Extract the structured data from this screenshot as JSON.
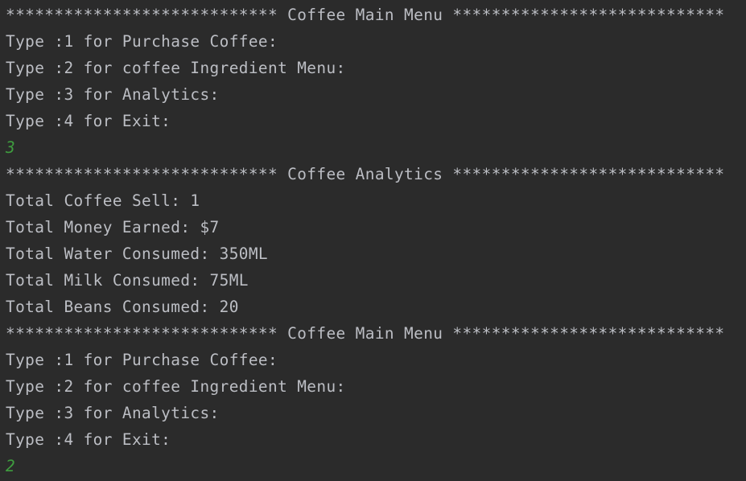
{
  "console": {
    "input_color": "#3f9d3f",
    "text_color": "#bcbec4",
    "background_color": "#2b2b2b",
    "lines": [
      {
        "text": "**************************** Coffee Main Menu ****************************",
        "kind": "output"
      },
      {
        "text": "Type :1 for Purchase Coffee:",
        "kind": "output"
      },
      {
        "text": "Type :2 for coffee Ingredient Menu:",
        "kind": "output"
      },
      {
        "text": "Type :3 for Analytics:",
        "kind": "output"
      },
      {
        "text": "Type :4 for Exit:",
        "kind": "output"
      },
      {
        "text": "3",
        "kind": "input"
      },
      {
        "text": "**************************** Coffee Analytics ****************************",
        "kind": "output"
      },
      {
        "text": "Total Coffee Sell: 1",
        "kind": "output"
      },
      {
        "text": "Total Money Earned: $7",
        "kind": "output"
      },
      {
        "text": "Total Water Consumed: 350ML",
        "kind": "output"
      },
      {
        "text": "Total Milk Consumed: 75ML",
        "kind": "output"
      },
      {
        "text": "Total Beans Consumed: 20",
        "kind": "output"
      },
      {
        "text": "**************************** Coffee Main Menu ****************************",
        "kind": "output"
      },
      {
        "text": "Type :1 for Purchase Coffee:",
        "kind": "output"
      },
      {
        "text": "Type :2 for coffee Ingredient Menu:",
        "kind": "output"
      },
      {
        "text": "Type :3 for Analytics:",
        "kind": "output"
      },
      {
        "text": "Type :4 for Exit:",
        "kind": "output"
      },
      {
        "text": "2",
        "kind": "input"
      }
    ]
  }
}
